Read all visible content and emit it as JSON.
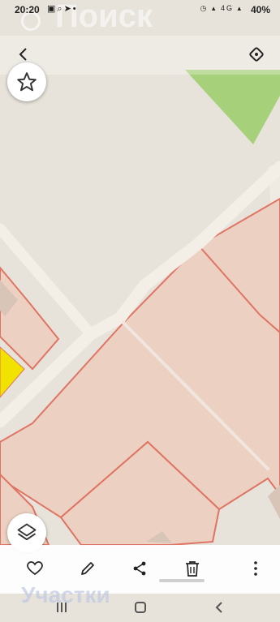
{
  "status_bar": {
    "time": "20:20",
    "left_icons": [
      "gallery-icon",
      "search-icon",
      "send-icon",
      "dot-icon"
    ],
    "right_icons": [
      "alarm-icon",
      "signal-icon",
      "4g-icon",
      "signal-icon"
    ],
    "network_label": "4G",
    "battery": "40%"
  },
  "header": {
    "background_title": "Поиск",
    "back_icon": "back-arrow-icon",
    "rotate_icon": "rotate-icon"
  },
  "map": {
    "colors": {
      "base": "#e7e3da",
      "park": "#a6d07a",
      "road": "#f3efe6",
      "parcel_fill": "#ecd1c2",
      "parcel_border": "#e07464",
      "highlight": "#f2e200"
    }
  },
  "buttons": {
    "favorite_icon": "star-icon",
    "layers_icon": "layers-icon"
  },
  "actions": {
    "items": [
      "heart-icon",
      "pencil-icon",
      "share-icon",
      "trash-icon",
      "more-icon"
    ]
  },
  "bottom_sheet": {
    "title": "Участки"
  },
  "nav_bar": {
    "items": [
      "recents-icon",
      "home-icon",
      "back-icon"
    ]
  }
}
